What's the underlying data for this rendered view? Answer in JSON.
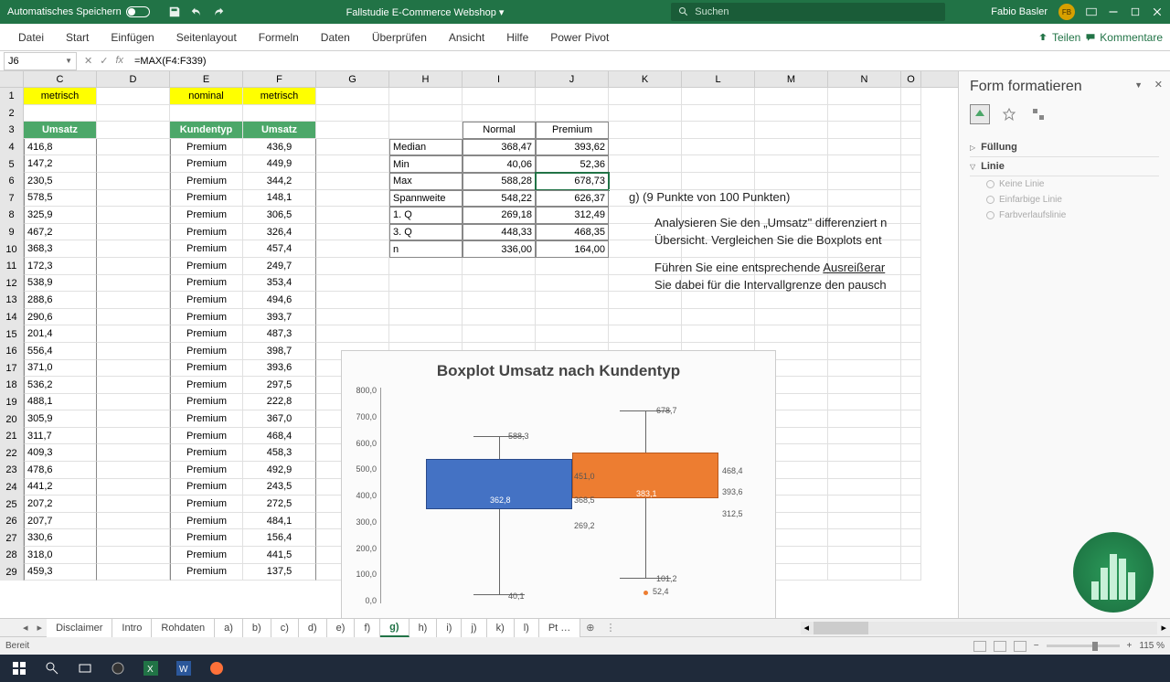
{
  "titlebar": {
    "autosave": "Automatisches Speichern",
    "doc": "Fallstudie E-Commerce Webshop",
    "search": "Suchen",
    "user": "Fabio Basler",
    "initials": "FB"
  },
  "ribbon": {
    "tabs": [
      "Datei",
      "Start",
      "Einfügen",
      "Seitenlayout",
      "Formeln",
      "Daten",
      "Überprüfen",
      "Ansicht",
      "Hilfe",
      "Power Pivot"
    ],
    "share": "Teilen",
    "comments": "Kommentare"
  },
  "formula": {
    "cell": "J6",
    "value": "=MAX(F4:F339)"
  },
  "cols": [
    "C",
    "D",
    "E",
    "F",
    "G",
    "H",
    "I",
    "J",
    "K",
    "L",
    "M",
    "N",
    "O"
  ],
  "headers": {
    "c1": "metrisch",
    "e1": "nominal",
    "f1": "metrisch",
    "c3": "Umsatz",
    "e3": "Kundentyp",
    "f3": "Umsatz"
  },
  "colC": [
    "416,8",
    "147,2",
    "230,5",
    "578,5",
    "325,9",
    "467,2",
    "368,3",
    "172,3",
    "538,9",
    "288,6",
    "290,6",
    "201,4",
    "556,4",
    "371,0",
    "536,2",
    "488,1",
    "305,9",
    "311,7",
    "409,3",
    "478,6",
    "441,2",
    "207,2",
    "207,7",
    "330,6",
    "318,0",
    "459,3"
  ],
  "colE": "Premium",
  "colF": [
    "436,9",
    "449,9",
    "344,2",
    "148,1",
    "306,5",
    "326,4",
    "457,4",
    "249,7",
    "353,4",
    "494,6",
    "393,7",
    "487,3",
    "398,7",
    "393,6",
    "297,5",
    "222,8",
    "367,0",
    "468,4",
    "458,3",
    "492,9",
    "243,5",
    "272,5",
    "484,1",
    "156,4",
    "441,5",
    "137,5"
  ],
  "stats": {
    "colN": "Normal",
    "colP": "Premium",
    "rows": [
      {
        "l": "Median",
        "n": "368,47",
        "p": "393,62"
      },
      {
        "l": "Min",
        "n": "40,06",
        "p": "52,36"
      },
      {
        "l": "Max",
        "n": "588,28",
        "p": "678,73"
      },
      {
        "l": "Spannweite",
        "n": "548,22",
        "p": "626,37"
      },
      {
        "l": "1. Q",
        "n": "269,18",
        "p": "312,49"
      },
      {
        "l": "3. Q",
        "n": "448,33",
        "p": "468,35"
      },
      {
        "l": "n",
        "n": "336,00",
        "p": "164,00"
      }
    ]
  },
  "task": {
    "hdr": "g) (9 Punkte von 100 Punkten)",
    "p1": "Analysieren Sie den „Umsatz\" differenziert n",
    "p2": "Übersicht. Vergleichen Sie die Boxplots ent",
    "p3a": "Führen Sie eine entsprechende ",
    "p3b": "Ausreißerar",
    "p4": "Sie dabei für die Intervallgrenze den pausch"
  },
  "chart_data": {
    "type": "boxplot",
    "title": "Boxplot Umsatz nach Kundentyp",
    "ylim": [
      0,
      800
    ],
    "yticks": [
      "800,0",
      "700,0",
      "600,0",
      "500,0",
      "400,0",
      "300,0",
      "200,0",
      "100,0",
      "0,0"
    ],
    "series": [
      {
        "name": "Normal",
        "min": 40.1,
        "q1": 269.2,
        "median": 368.5,
        "mean": 362.8,
        "q3": 451.0,
        "max": 588.3
      },
      {
        "name": "Premium",
        "min": 101.2,
        "q1": 312.5,
        "median": 393.6,
        "mean": 383.1,
        "q3": 468.4,
        "max": 678.7,
        "outliers": [
          52.4
        ]
      }
    ],
    "labels": {
      "n_max": "588,3",
      "n_q3": "451,0",
      "n_med": "368,5",
      "n_mean": "362,8",
      "n_q1": "269,2",
      "n_min": "40,1",
      "p_max": "678,7",
      "p_q3": "468,4",
      "p_med": "393,6",
      "p_mean": "383,1",
      "p_q1": "312,5",
      "p_min": "101,2",
      "p_out": "52,4"
    }
  },
  "pane": {
    "title": "Form formatieren",
    "fill": "Füllung",
    "line": "Linie",
    "none": "Keine Linie",
    "solid": "Einfarbige Linie",
    "grad": "Farbverlaufslinie"
  },
  "sheets": [
    "Disclaimer",
    "Intro",
    "Rohdaten",
    "a)",
    "b)",
    "c)",
    "d)",
    "e)",
    "f)",
    "g)",
    "h)",
    "i)",
    "j)",
    "k)",
    "l)",
    "Pt …"
  ],
  "active_sheet": "g)",
  "status": {
    "ready": "Bereit",
    "zoom": "115 %"
  }
}
